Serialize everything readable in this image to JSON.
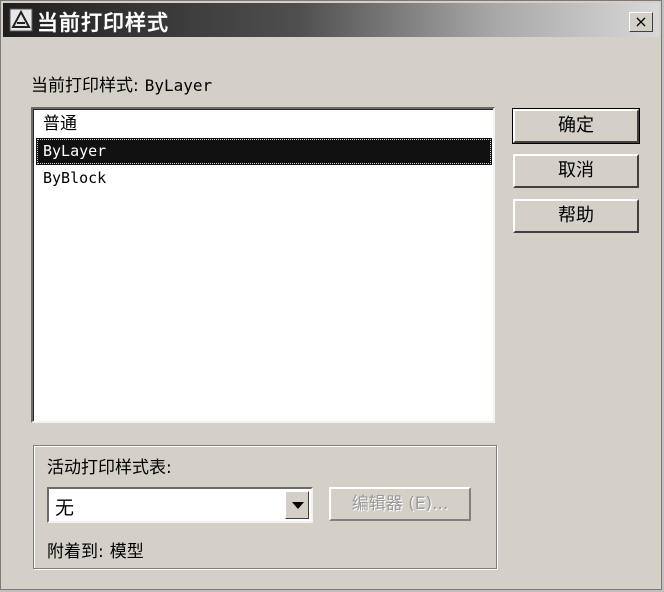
{
  "window": {
    "title": "当前打印样式",
    "close_glyph": "×",
    "icon": "autocad-app-icon"
  },
  "current_style": {
    "label": "当前打印样式:",
    "value": "ByLayer"
  },
  "style_list": {
    "items": [
      {
        "label": "普通",
        "selected": false
      },
      {
        "label": "ByLayer",
        "selected": true
      },
      {
        "label": "ByBlock",
        "selected": false
      }
    ]
  },
  "buttons": {
    "ok": "确定",
    "cancel": "取消",
    "help": "帮助"
  },
  "active_table": {
    "group_label": "活动打印样式表:",
    "selected_value": "无",
    "editor_button": "编辑器 (E)...",
    "editor_enabled": false,
    "attached_to_label": "附着到:",
    "attached_to_value": "模型"
  },
  "colors": {
    "title_bar_start": "#1f1f1f",
    "title_bar_end": "#d8d8d8",
    "dialog_bg": "#d4d0c8",
    "selection_bg": "#111111"
  }
}
